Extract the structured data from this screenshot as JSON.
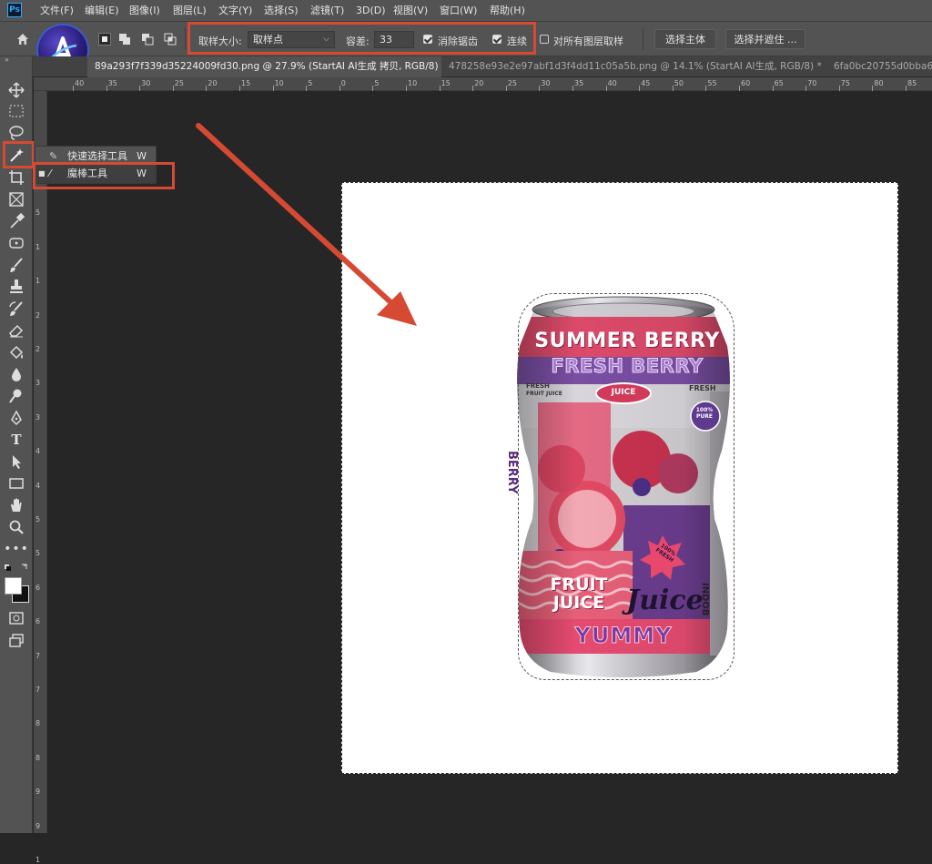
{
  "app": {
    "logo": "Ps",
    "menu": [
      "文件(F)",
      "编辑(E)",
      "图像(I)",
      "图层(L)",
      "文字(Y)",
      "选择(S)",
      "滤镜(T)",
      "3D(D)",
      "视图(V)",
      "窗口(W)",
      "帮助(H)"
    ]
  },
  "options": {
    "sample_size_label": "取样大小:",
    "sample_size_value": "取样点",
    "tolerance_label": "容差:",
    "tolerance_value": "33",
    "antialias_label": "消除锯齿",
    "antialias_checked": true,
    "contiguous_label": "连续",
    "contiguous_checked": true,
    "sample_all_label": "对所有图层取样",
    "sample_all_checked": false,
    "select_subject": "选择主体",
    "select_mask": "选择并遮住 ..."
  },
  "tabs": [
    {
      "title": "89a293f7f339d35224009fd30.png @ 27.9% (StartAI AI生成 拷贝, RGB/8) *",
      "active": true
    },
    {
      "title": "478258e93e2e97abf1d3f4dd11c05a5b.png @ 14.1% (StartAI AI生成, RGB/8) *",
      "active": false
    },
    {
      "title": "6fa0bc20755d0bba6f",
      "active": false
    }
  ],
  "ruler": {
    "h_labels": [
      "40",
      "35",
      "30",
      "25",
      "20",
      "15",
      "10",
      "5",
      "0",
      "5",
      "10",
      "15",
      "20",
      "25",
      "30",
      "35",
      "40",
      "45",
      "50",
      "55",
      "60",
      "65",
      "70",
      "75",
      "80",
      "85"
    ],
    "v_labels": [
      "0",
      "5",
      "1",
      "1",
      "2",
      "2",
      "3",
      "3",
      "4",
      "4",
      "5",
      "5",
      "6",
      "6",
      "7",
      "7",
      "8",
      "8",
      "9",
      "9",
      "1"
    ]
  },
  "flyout": {
    "items": [
      {
        "label": "快速选择工具",
        "shortcut": "W"
      },
      {
        "label": "魔棒工具",
        "shortcut": "W"
      }
    ]
  },
  "can": {
    "line1": "SUMMER BERRY",
    "line2": "FRESH BERRY",
    "tag_fresh_left": "FRESH",
    "tag_fruit_juice": "FRUIT JUICE",
    "badge": "JUICE",
    "tag_fresh_right": "FRESH",
    "pure": "100% PURE",
    "side": "BERRY",
    "fruit_juice_1": "FRUIT",
    "fruit_juice_2": "JUICE",
    "script": "Juice",
    "star": "100% FRESH",
    "yummy": "YUMMY",
    "vertical": "INDOB"
  },
  "colors": {
    "accent_red": "#d64a33",
    "can_pink": "#e4556e",
    "can_purple": "#6b3d8e",
    "can_silver": "#c9c6c9"
  }
}
